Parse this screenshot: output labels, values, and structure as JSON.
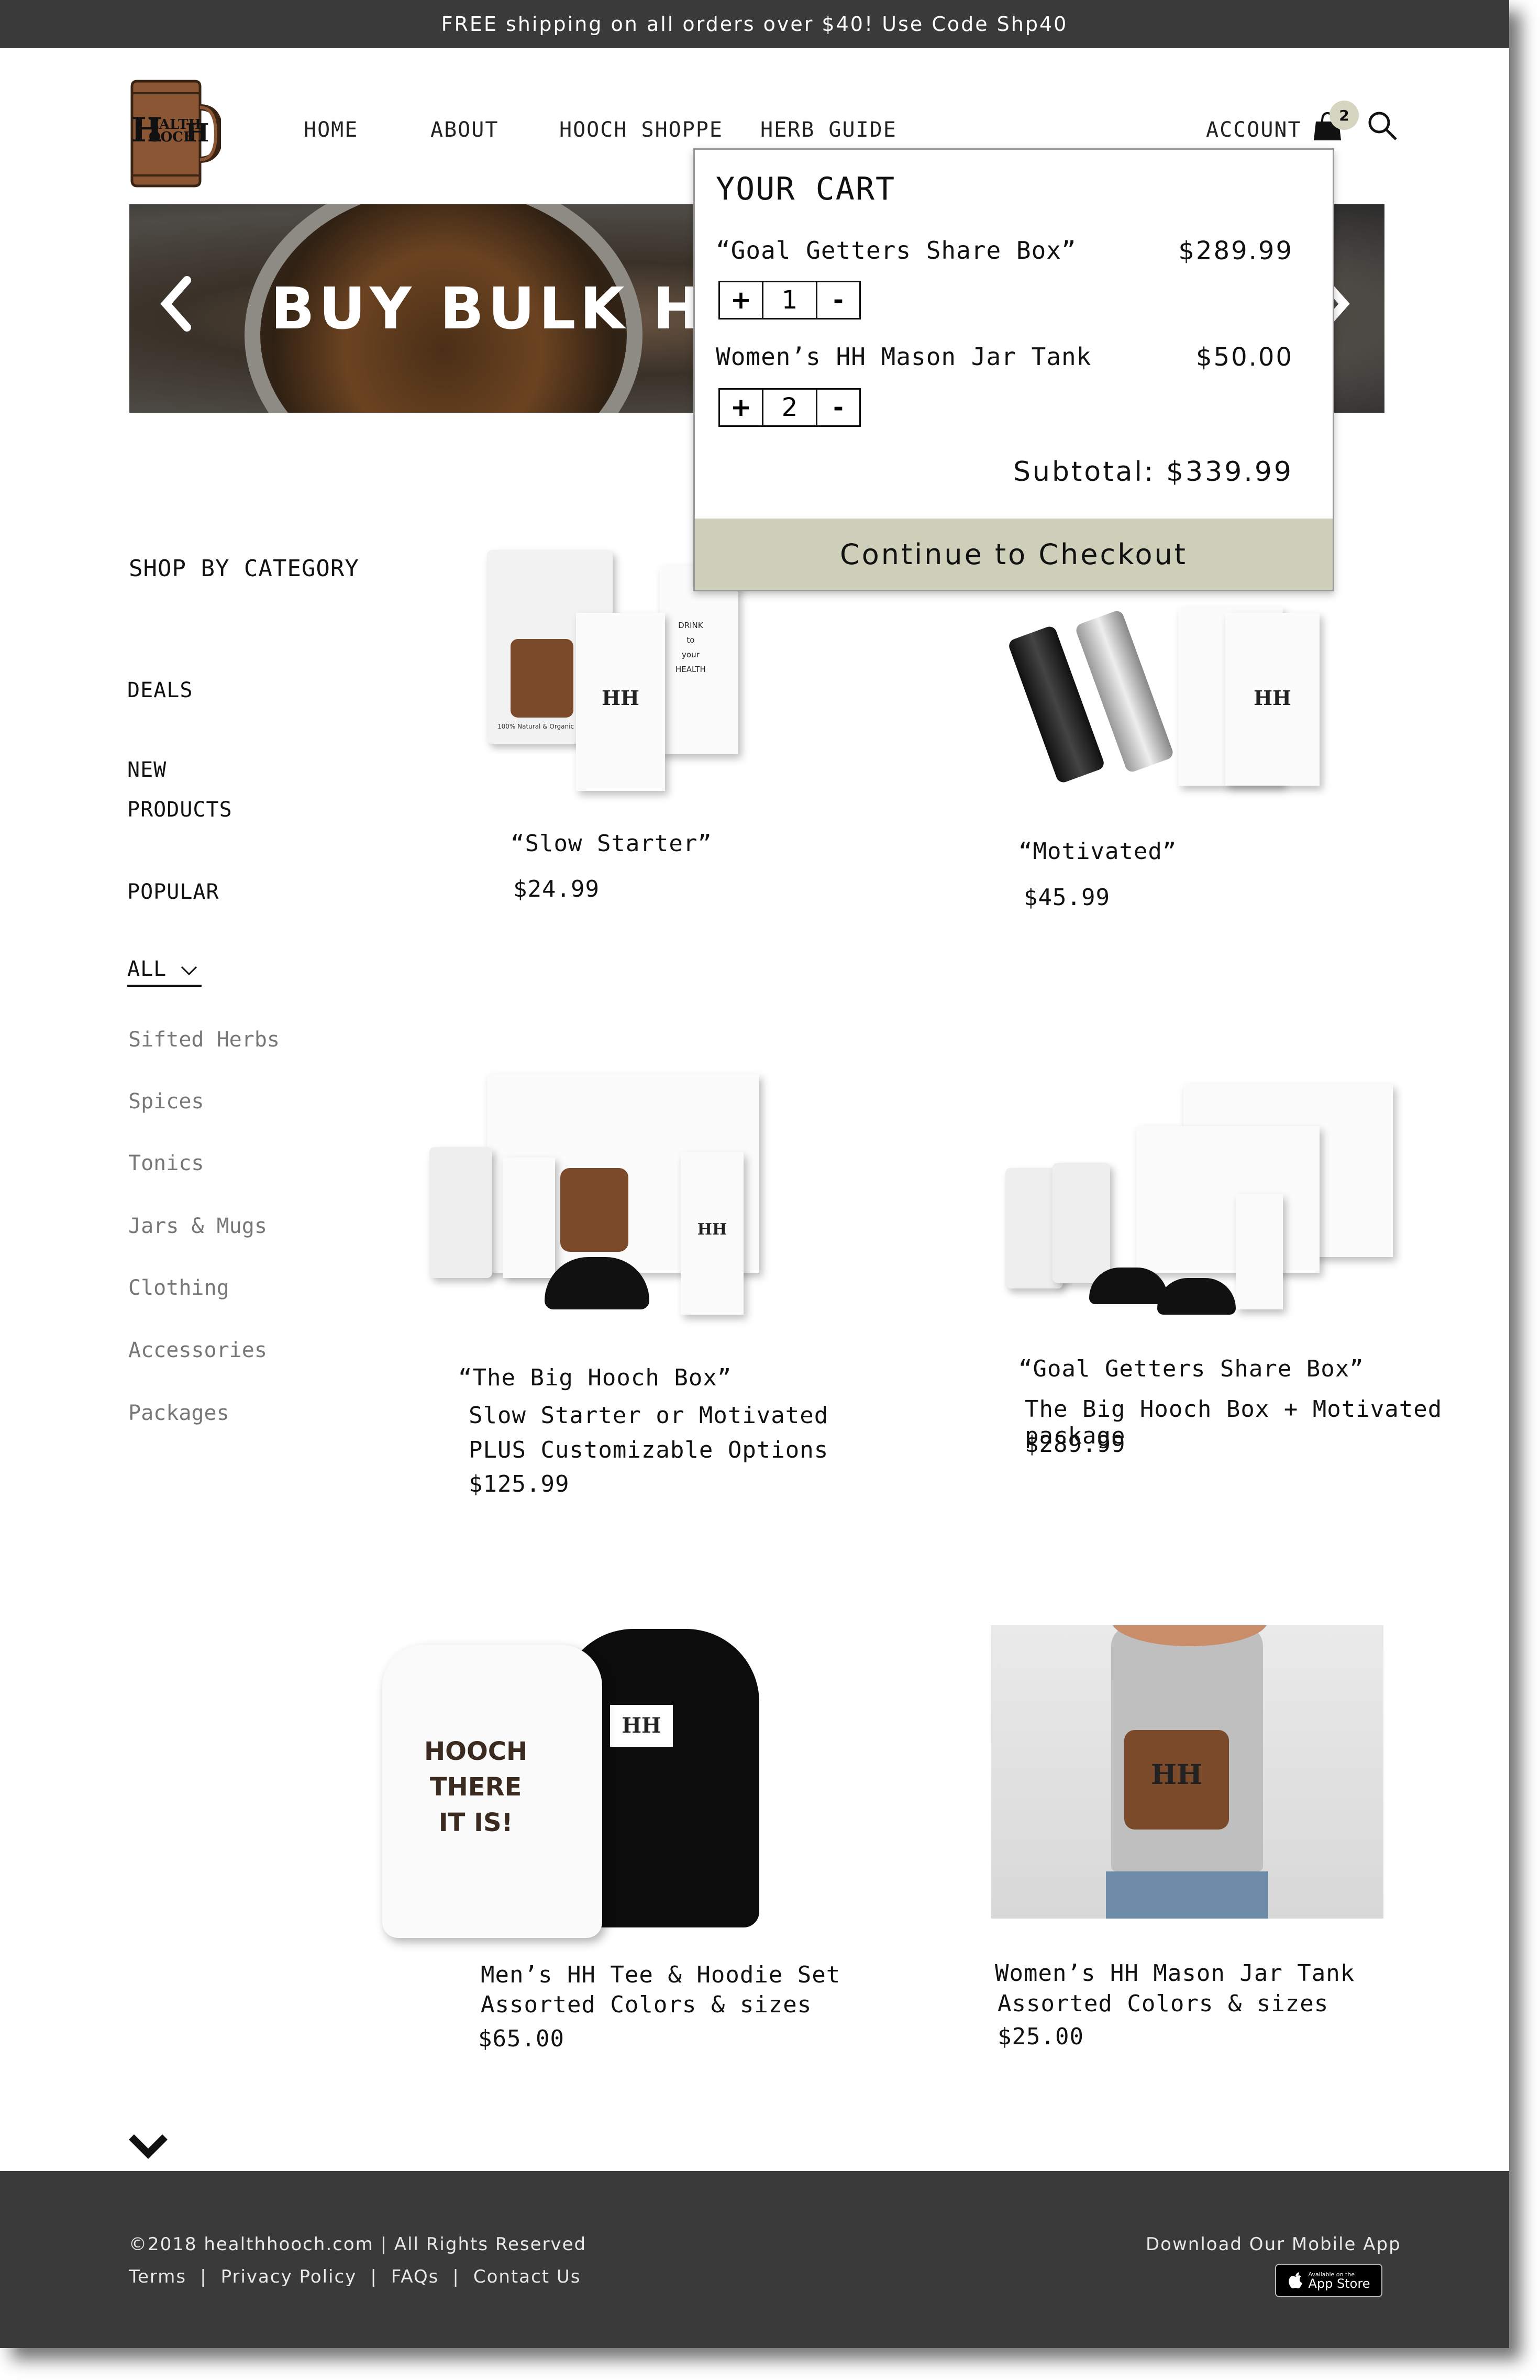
{
  "banner": {
    "text": "FREE shipping on all orders over $40! Use Code Shp40"
  },
  "logo": {
    "text_line1": "EALTH",
    "text_line2": "OOCH",
    "letter_h": "H"
  },
  "nav": {
    "home": "HOME",
    "about": "ABOUT",
    "shoppe": "HOOCH SHOPPE",
    "herb_guide": "HERB GUIDE",
    "account": "ACCOUNT",
    "cart_count": "2"
  },
  "hero": {
    "title": "BUY BULK HERBS"
  },
  "cart": {
    "title": "YOUR CART",
    "items": [
      {
        "name": "“Goal Getters Share Box”",
        "price": "$289.99",
        "qty": "1"
      },
      {
        "name": "Women’s HH Mason Jar Tank",
        "price": "$50.00",
        "qty": "2"
      }
    ],
    "plus": "+",
    "minus": "-",
    "subtotal": "Subtotal: $339.99",
    "checkout": "Continue to Checkout"
  },
  "sidebar": {
    "heading": "SHOP BY CATEGORY",
    "deals": "DEALS",
    "new_line1": "NEW",
    "new_line2": "PRODUCTS",
    "popular": "POPULAR",
    "all": "ALL",
    "subs": [
      "Sifted Herbs",
      "Spices",
      "Tonics",
      "Jars & Mugs",
      "Clothing",
      "Accessories",
      "Packages"
    ]
  },
  "products": [
    {
      "title": "“Slow Starter”",
      "price": "$24.99"
    },
    {
      "title": "“Motivated”",
      "price": "$45.99"
    },
    {
      "title": "“The Big Hooch Box”",
      "line1": "Slow Starter or Motivated",
      "line2": "PLUS Customizable Options",
      "price": "$125.99"
    },
    {
      "title": "“Goal Getters Share Box”",
      "line1": "The Big Hooch Box + Motivated package",
      "price": "$289.99"
    },
    {
      "title": "Men’s HH Tee & Hoodie Set",
      "line1": "Assorted Colors & sizes",
      "price": "$65.00"
    },
    {
      "title": "Women’s HH Mason Jar Tank",
      "line1": "Assorted Colors & sizes",
      "price": "$25.00"
    }
  ],
  "tee_text": [
    "HOOCH",
    "THERE",
    "IT IS!"
  ],
  "pouch_text": "100% Natural & Organic",
  "box_text": [
    "DRINK",
    "to",
    "your",
    "HEALTH"
  ],
  "footer": {
    "copyright": "©2018 healthhooch.com |  All Rights Reserved",
    "terms": "Terms",
    "privacy": "Privacy Policy",
    "faqs": "FAQs",
    "contact": "Contact Us",
    "sep": "|",
    "app_label": "Download Our Mobile App",
    "appstore_small": "Available on the",
    "appstore_big": "App Store"
  },
  "colors": {
    "banner_bg": "#3a3a3a",
    "checkout_bg": "#cdcfb8",
    "mug_brown": "#7a4a2b",
    "cart_badge": "#d6d6c0"
  }
}
